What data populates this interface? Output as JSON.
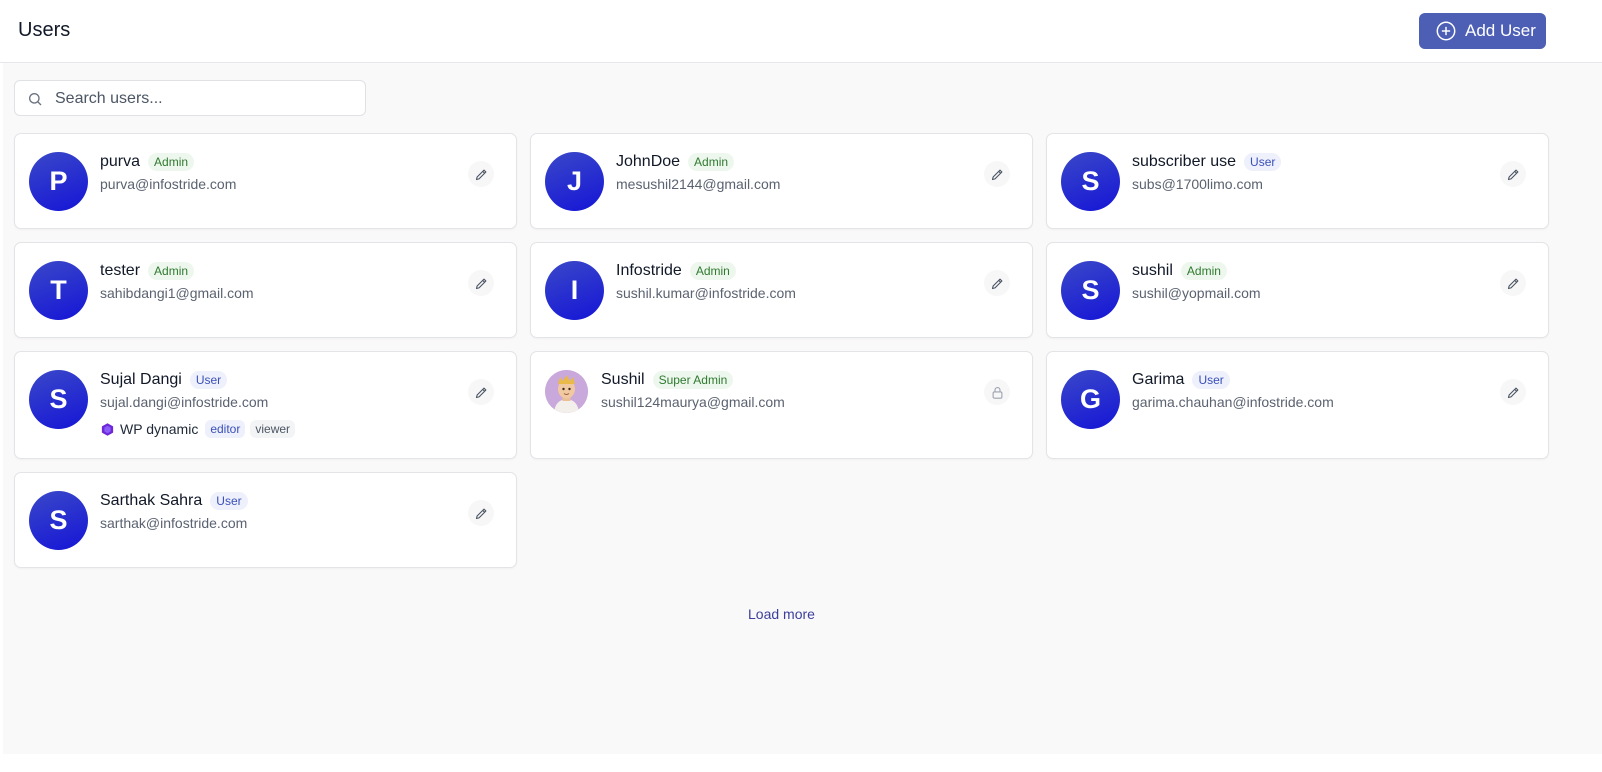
{
  "header": {
    "title": "Users",
    "add_user_label": "Add User"
  },
  "search": {
    "placeholder": "Search users..."
  },
  "users": [
    {
      "initial": "P",
      "name": "purva",
      "role": "Admin",
      "email": "purva@infostride.com",
      "action": "edit"
    },
    {
      "initial": "J",
      "name": "JohnDoe",
      "role": "Admin",
      "email": "mesushil2144@gmail.com",
      "action": "edit"
    },
    {
      "initial": "S",
      "name": "subscriber use",
      "role": "User",
      "email": "subs@1700limo.com",
      "action": "edit"
    },
    {
      "initial": "T",
      "name": "tester",
      "role": "Admin",
      "email": "sahibdangi1@gmail.com",
      "action": "edit"
    },
    {
      "initial": "I",
      "name": "Infostride",
      "role": "Admin",
      "email": "sushil.kumar@infostride.com",
      "action": "edit"
    },
    {
      "initial": "S",
      "name": "sushil",
      "role": "Admin",
      "email": "sushil@yopmail.com",
      "action": "edit"
    },
    {
      "initial": "S",
      "name": "Sujal Dangi",
      "role": "User",
      "email": "sujal.dangi@infostride.com",
      "action": "edit",
      "org": {
        "name": "WP dynamic",
        "roles": [
          "editor",
          "viewer"
        ]
      }
    },
    {
      "initial": "",
      "name": "Sushil",
      "role": "Super Admin",
      "email": "sushil124maurya@gmail.com",
      "action": "locked"
    },
    {
      "initial": "G",
      "name": "Garima",
      "role": "User",
      "email": "garima.chauhan@infostride.com",
      "action": "edit"
    },
    {
      "initial": "S",
      "name": "Sarthak Sahra",
      "role": "User",
      "email": "sarthak@infostride.com",
      "action": "edit"
    }
  ],
  "footer": {
    "load_more_label": "Load more"
  },
  "colors": {
    "primary": "#4c5fb5",
    "avatar_gradient_start": "#3a48c8",
    "avatar_gradient_end": "#1515d6",
    "admin_badge": "#2f7a2f",
    "user_badge": "#3a50b8"
  }
}
